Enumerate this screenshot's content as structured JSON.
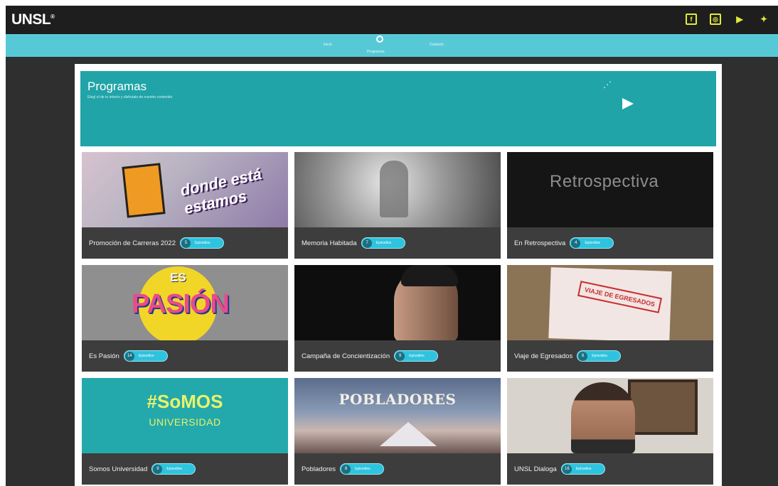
{
  "brand": {
    "logo": "UNSL",
    "logo_sup": "®"
  },
  "social": [
    {
      "name": "facebook",
      "glyph": "f"
    },
    {
      "name": "instagram",
      "glyph": "◎"
    },
    {
      "name": "youtube",
      "glyph": "▶"
    },
    {
      "name": "twitter",
      "glyph": "✦"
    }
  ],
  "nav": {
    "items": [
      {
        "label": "Inicio",
        "active": false
      },
      {
        "label": "Programas",
        "active": true
      },
      {
        "label": "Contacto",
        "active": false
      }
    ]
  },
  "banner": {
    "title": "Programas",
    "subtitle": "Elegí el de tu interés y disfrutalo de nuestro contenido"
  },
  "pill_label": "Episodios",
  "programs": [
    {
      "title": "Promoción de Carreras 2022",
      "count": "5"
    },
    {
      "title": "Memoria Habitada",
      "count": "7"
    },
    {
      "title": "En Retrospectiva",
      "count": "4"
    },
    {
      "title": "Es Pasión",
      "count": "14"
    },
    {
      "title": "Campaña de Concientización",
      "count": "9"
    },
    {
      "title": "Viaje de Egresados",
      "count": "6"
    },
    {
      "title": "Somos Universidad",
      "count": "9"
    },
    {
      "title": "Pobladores",
      "count": "8"
    },
    {
      "title": "UNSL Dialoga",
      "count": "16"
    }
  ],
  "thumbs": {
    "promo_text": "donde está estamos",
    "retro_text": "Retrospectiva",
    "pasion_es": "ES",
    "pasion_word": "PASIÓN",
    "viaje_stamp": "VIAJE DE EGRESADOS",
    "somos_1": "#SoMOS",
    "somos_2": "UNIVERSIDAD",
    "pobl_text": "POBLADORES"
  },
  "colors": {
    "topbar": "#1e1e1e",
    "nav": "#57c9d6",
    "banner": "#20a4a8",
    "pill": "#2ec3de",
    "social": "#e2ea3a"
  }
}
